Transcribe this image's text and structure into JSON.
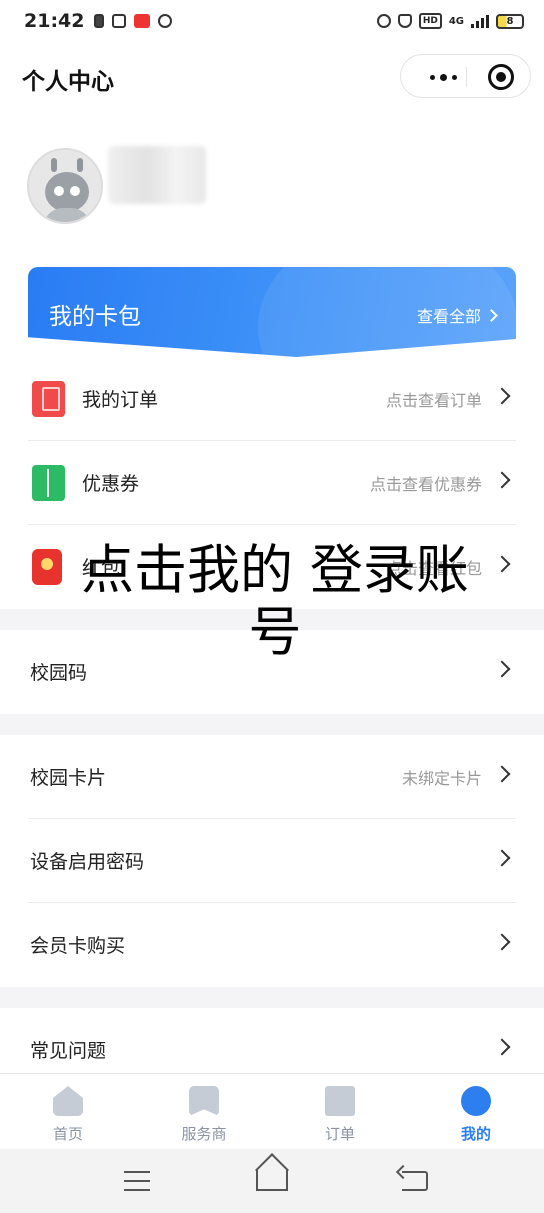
{
  "status_bar": {
    "time": "21:42",
    "network": "4G",
    "battery": "8"
  },
  "header": {
    "title": "个人中心"
  },
  "wallet": {
    "title": "我的卡包",
    "view_all": "查看全部"
  },
  "list1": [
    {
      "label": "我的订单",
      "hint": "点击查看订单",
      "icon": "order-icon"
    },
    {
      "label": "优惠券",
      "hint": "点击查看优惠券",
      "icon": "coupon-icon"
    },
    {
      "label": "红包",
      "hint": "点击查看红包",
      "icon": "red-packet-icon"
    }
  ],
  "campus_code": {
    "label": "校园码"
  },
  "list2": [
    {
      "label": "校园卡片",
      "hint": "未绑定卡片"
    },
    {
      "label": "设备启用密码",
      "hint": ""
    },
    {
      "label": "会员卡购买",
      "hint": ""
    }
  ],
  "faq": {
    "label": "常见问题"
  },
  "overlay": {
    "text": "点击我的 登录账号"
  },
  "tabbar": [
    {
      "label": "首页",
      "icon": "home-icon",
      "active": false
    },
    {
      "label": "服务商",
      "icon": "bookmark-icon",
      "active": false
    },
    {
      "label": "订单",
      "icon": "document-icon",
      "active": false
    },
    {
      "label": "我的",
      "icon": "profile-icon",
      "active": true
    }
  ],
  "colors": {
    "accent": "#2d7ff0",
    "wallet_gradient_start": "#2a7cf3",
    "wallet_gradient_end": "#5aa3fb"
  }
}
